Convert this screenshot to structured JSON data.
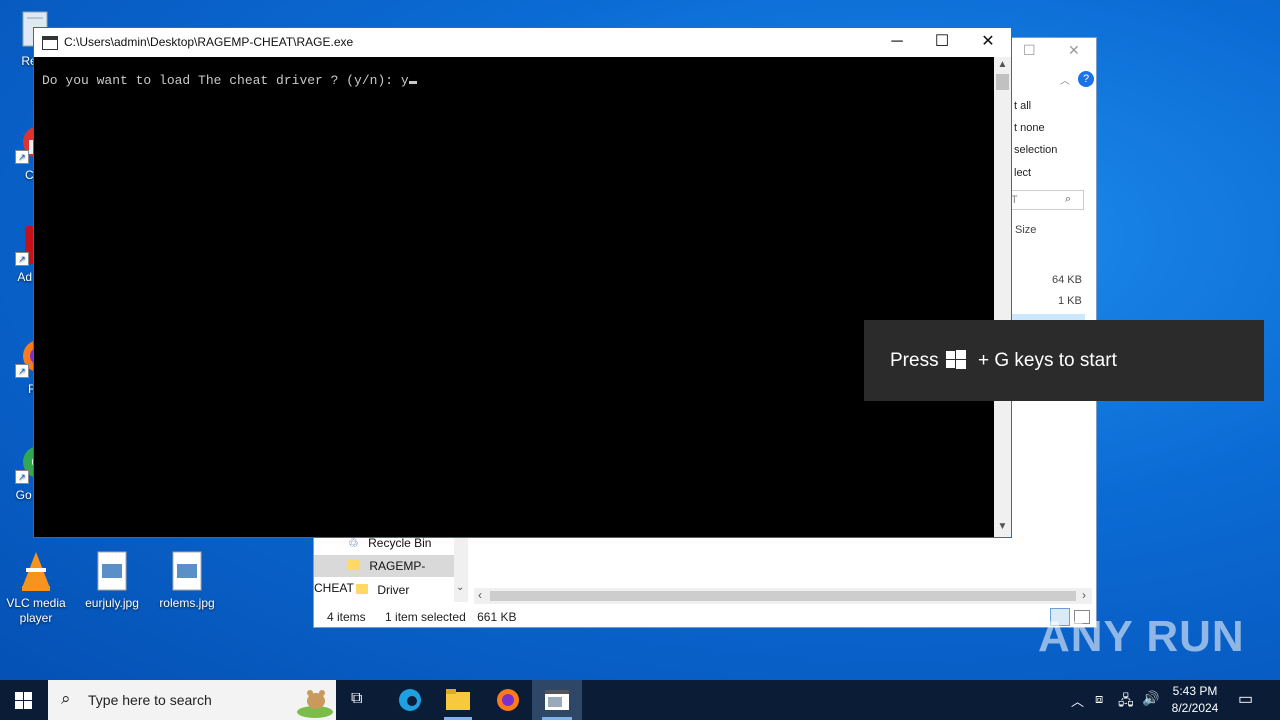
{
  "desktop": {
    "icons": [
      {
        "label": "Recy"
      },
      {
        "label": "CCl"
      },
      {
        "label": "Ad Acr"
      },
      {
        "label": "Fir"
      },
      {
        "label": "Go Chr"
      },
      {
        "label": "VLC media player"
      },
      {
        "label": "eurjuly.jpg"
      },
      {
        "label": "rolems.jpg"
      }
    ]
  },
  "explorer": {
    "ribbon": [
      "t all",
      "t none",
      "selection",
      "lect"
    ],
    "search_text": "T",
    "column_size": "Size",
    "sizes": [
      "64 KB",
      "1 KB"
    ],
    "tree": [
      "Recycle Bin",
      "RAGEMP-CHEAT",
      "Driver"
    ],
    "status_items": "4 items",
    "status_selected": "1 item selected",
    "status_size": "661 KB"
  },
  "console": {
    "title": "C:\\Users\\admin\\Desktop\\RAGEMP-CHEAT\\RAGE.exe",
    "prompt": "Do you want to load The cheat driver ? (y/n): y",
    "minimize": "─",
    "maximize": "☐",
    "close": "✕"
  },
  "toast": {
    "press": "Press",
    "rest": "+ G keys to start"
  },
  "taskbar": {
    "search_placeholder": "Type here to search",
    "time": "5:43 PM",
    "date": "8/2/2024"
  },
  "watermark": "ANY RUN"
}
